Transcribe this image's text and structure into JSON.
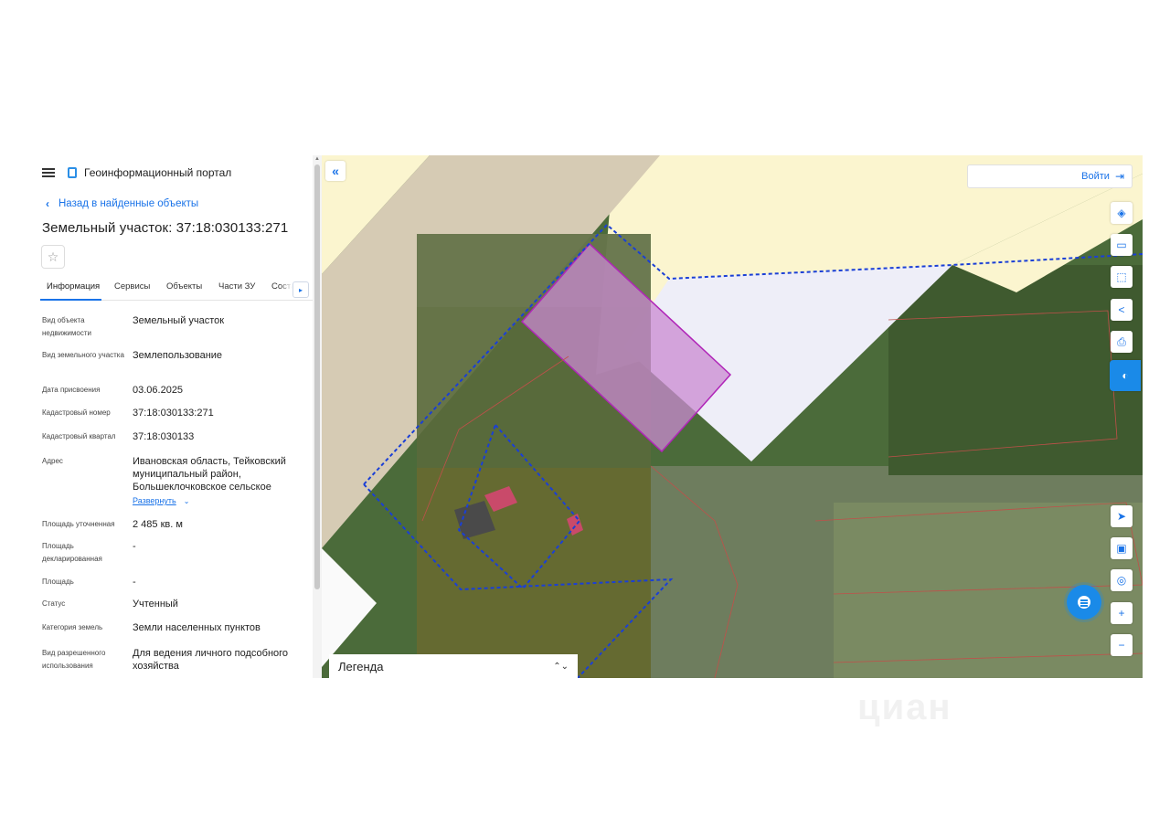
{
  "header": {
    "menu_icon": "menu-icon",
    "logo_icon": "portal-logo-icon",
    "app_title": "Геоинформационный портал"
  },
  "back_link": "Назад в найденные объекты",
  "object_title": "Земельный участок: 37:18:030133:271",
  "favorite_icon": "star-icon",
  "tabs": [
    {
      "label": "Информация",
      "active": true
    },
    {
      "label": "Сервисы"
    },
    {
      "label": "Объекты"
    },
    {
      "label": "Части ЗУ"
    },
    {
      "label": "Соста"
    }
  ],
  "properties": [
    {
      "label": "Вид объекта недвижимости",
      "value": "Земельный участок"
    },
    {
      "label": "Вид земельного участка",
      "value": "Землепользование"
    },
    {
      "label": "Дата присвоения",
      "value": "03.06.2025"
    },
    {
      "label": "Кадастровый номер",
      "value": "37:18:030133:271"
    },
    {
      "label": "Кадастровый квартал",
      "value": "37:18:030133"
    },
    {
      "label": "Адрес",
      "value": "Ивановская область, Тейковский муниципальный район, Большеклочковское сельское"
    },
    {
      "label": "Площадь уточненная",
      "value": "2 485 кв. м"
    },
    {
      "label": "Площадь декларированная",
      "value": "-"
    },
    {
      "label": "Площадь",
      "value": "-"
    },
    {
      "label": "Статус",
      "value": "Учтенный"
    },
    {
      "label": "Категория земель",
      "value": "Земли населенных пунктов"
    },
    {
      "label": "Вид разрешенного использования",
      "value": "Для ведения личного подсобного хозяйства"
    }
  ],
  "expand_link": "Развернуть",
  "map": {
    "collapse_label": "«",
    "login_label": "Войти",
    "legend_label": "Легенда",
    "tools": [
      "layers-icon",
      "ruler-icon",
      "area-select-icon",
      "share-icon",
      "print-icon",
      "portal-badge-icon",
      "locate-icon",
      "minimap-icon",
      "pin-icon",
      "zoom-in-icon",
      "zoom-out-icon"
    ],
    "zoom_in_label": "+",
    "zoom_out_label": "−",
    "colors": {
      "accent": "#1a73e8",
      "parcel_outline": "#1a3fd6",
      "highlight": "#c060c8"
    }
  },
  "watermark": "циан"
}
